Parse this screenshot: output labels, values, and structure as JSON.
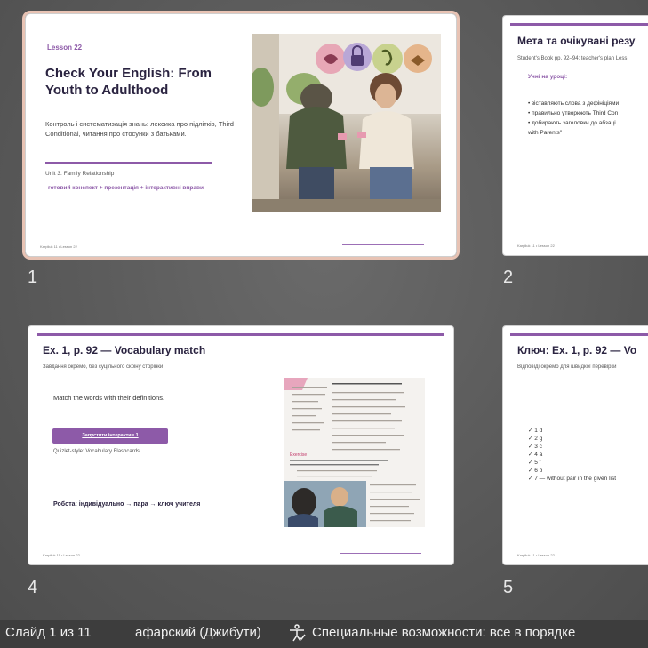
{
  "slides": [
    {
      "number": "1",
      "lesson": "Lesson 22",
      "title": "Check Your English: From Youth to Adulthood",
      "description": "Контроль і систематизація знань: лексика про підлітків, Third Conditional, читання про стосунки з батьками.",
      "unit": "Unit 3. Family Relationship",
      "tagline": "готовий конспект + презентація + інтерактивні вправи",
      "footer": "Karpliuk 11 • Lesson 22"
    },
    {
      "number": "2",
      "title": "Мета та очікувані резу",
      "subtitle": "Student's Book pp. 92–94; teacher's plan Less",
      "section": "Учні на уроці:",
      "bullets": [
        "• зіставляють слова з дефініціями",
        "• правильно утворюють Third Con",
        "• добирають заголовки до абзаці",
        "with Parents\""
      ],
      "footer": "Karpliuk 11 • Lesson 22"
    },
    {
      "number": "4",
      "title": "Ex. 1, p. 92 — Vocabulary match",
      "subtitle": "Завдання окремо, без суцільного скріну сторінки",
      "instruction": "Match the words with their definitions.",
      "button": "Запустити інтерактив 1",
      "quizlet": "Quizlet-style: Vocabulary Flashcards",
      "work": "Робота: індивідуально → пара → ключ учителя",
      "footer": "Karpliuk 11 • Lesson 22"
    },
    {
      "number": "5",
      "title": "Ключ: Ex. 1, p. 92 — Vo",
      "subtitle": "Відповіді окремо для швидкої перевірки",
      "answers": [
        "✓ 1 d",
        "✓ 2 g",
        "✓ 3 c",
        "✓ 4 a",
        "✓ 5 f",
        "✓ 6 b",
        "✓ 7 — without pair in the given list"
      ],
      "footer": "Karpliuk 11 • Lesson 22"
    }
  ],
  "status_bar": {
    "slide_counter": "Слайд 1 из 11",
    "language": "афарский (Джибути)",
    "accessibility": "Специальные возможности: все в порядке"
  },
  "colors": {
    "accent": "#8d5aa8",
    "selection": "#e8c3b4",
    "status_bg": "#3d3d3d"
  }
}
